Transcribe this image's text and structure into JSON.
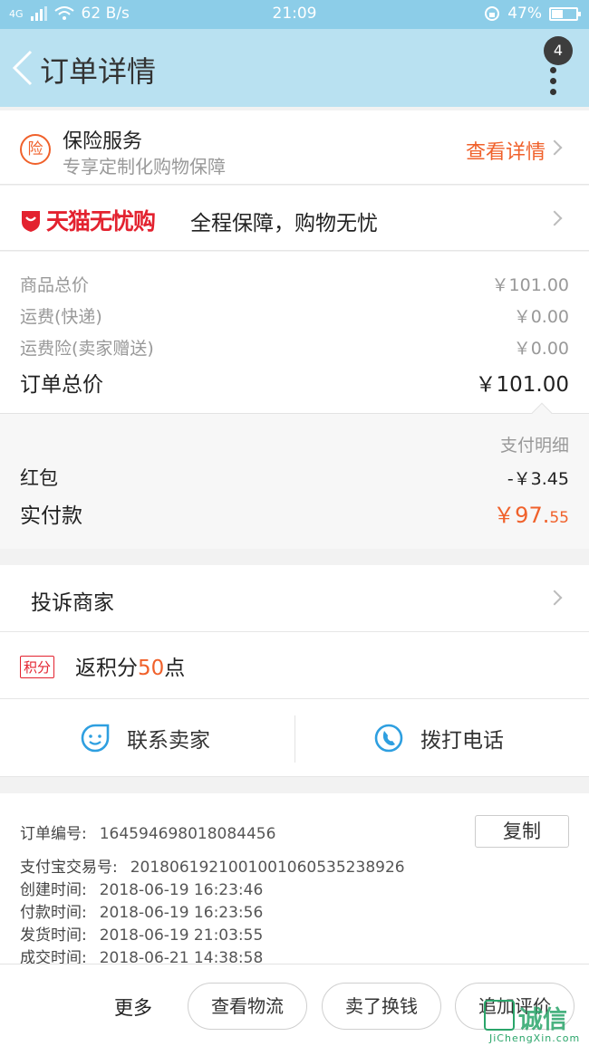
{
  "status_bar": {
    "network": "4G",
    "speed": "62 B/s",
    "time": "21:09",
    "battery": "47%"
  },
  "nav": {
    "title": "订单详情",
    "badge_count": "4"
  },
  "insurance": {
    "icon_char": "险",
    "title": "保险服务",
    "subtitle": "专享定制化购物保障",
    "link": "查看详情"
  },
  "tmall": {
    "brand": "天猫无忧购",
    "text": "全程保障，购物无忧"
  },
  "prices": {
    "goods_label": "商品总价",
    "goods_value": "￥101.00",
    "shipping_label": "运费(快递)",
    "shipping_value": "￥0.00",
    "insurance_label": "运费险(卖家赠送)",
    "insurance_value": "￥0.00",
    "total_label": "订单总价",
    "total_value": "￥101.00"
  },
  "payment": {
    "detail_label": "支付明细",
    "redpacket_label": "红包",
    "redpacket_value": "-￥3.45",
    "paid_label": "实付款",
    "paid_main": "￥97.",
    "paid_cents": "55"
  },
  "complaint": {
    "label": "投诉商家"
  },
  "points": {
    "tag": "积分",
    "prefix": "返积分",
    "amount": "50",
    "suffix": "点"
  },
  "contact": {
    "seller": "联系卖家",
    "call": "拨打电话"
  },
  "order_info": {
    "order_no_label": "订单编号:",
    "order_no": "164594698018084456",
    "copy": "复制",
    "alipay_label": "支付宝交易号:",
    "alipay_no": "2018061921001001060535238926",
    "created_label": "创建时间:",
    "created": "2018-06-19 16:23:46",
    "paid_label": "付款时间:",
    "paid": "2018-06-19 16:23:56",
    "shipped_label": "发货时间:",
    "shipped": "2018-06-19 21:03:55",
    "done_label": "成交时间:",
    "done": "2018-06-21 14:38:58"
  },
  "bottom": {
    "more": "更多",
    "logistics": "查看物流",
    "sell": "卖了换钱",
    "review": "追加评价"
  },
  "watermark": {
    "text": "诚信",
    "url": "JiChengXin.com"
  },
  "colors": {
    "nav_bg": "#b9e1f1",
    "status_bg": "#8ccde8",
    "accent_orange": "#f0612b",
    "tmall_red": "#e3222f",
    "icon_blue": "#2e9fe0"
  }
}
